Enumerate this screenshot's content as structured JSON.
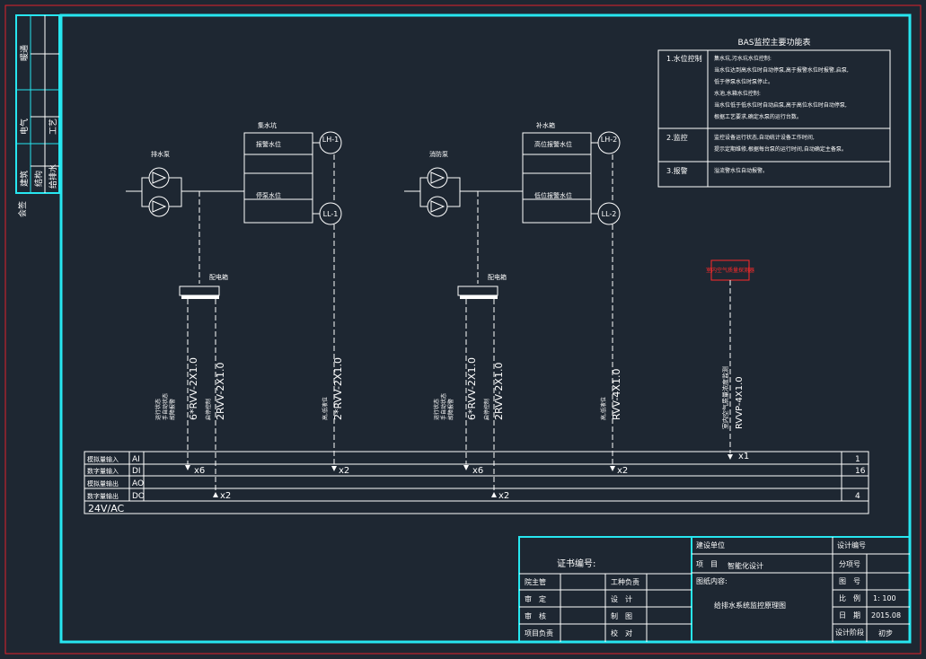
{
  "side_block": {
    "labels": [
      "暖通",
      "电气",
      "工艺",
      "建筑",
      "结构",
      "给排水"
    ],
    "company": "会签"
  },
  "sections": [
    {
      "pump_label": "排水泵",
      "tank_label": "集水坑",
      "level_high": "报警水位",
      "level_low": "停泵水位",
      "sensor_high": "LH-1",
      "sensor_low": "LL-1",
      "box_label": "配电箱",
      "cable1_desc": [
        "运行状态",
        "手自动状态",
        "故障报警"
      ],
      "cable1": "6*RVV-2X1.0",
      "cable2_desc": "启停控制",
      "cable2": "2RVV-2X1.0",
      "cable3_desc": "高,低液位",
      "cable3": "2*RVV-2X1.0",
      "di_count1": "x6",
      "do_count": "x2",
      "di_count2": "x2"
    },
    {
      "pump_label": "消防泵",
      "tank_label": "补水箱",
      "level_high": "高位报警水位",
      "level_low": "低位报警水位",
      "sensor_high": "LH-2",
      "sensor_low": "LL-2",
      "box_label": "配电箱",
      "cable1_desc": [
        "运行状态",
        "手自动状态",
        "故障报警"
      ],
      "cable1": "6*RVV-2X1.0",
      "cable2_desc": "启停控制",
      "cable2": "2RVV-2X1.0",
      "cable3_desc": "高,低液位",
      "cable3": "RVV-4X1.0",
      "di_count1": "x6",
      "do_count": "x2",
      "di_count2": "x2"
    }
  ],
  "gas_detector": {
    "label": "室内空气质量探测器",
    "cable_desc": "室内空气质量浓度监测",
    "cable": "RVVP-4X1.0",
    "ai_count": "x1"
  },
  "bas_table": {
    "title": "BAS监控主要功能表",
    "rows": [
      {
        "name": "1.水位控制",
        "lines": [
          "集水坑,污水坑水位控制:",
          "当水位达到高水位时自动停泵,高于报警水位时报警,启泵,",
          "低于停泵水位时泵停止。",
          "水池,水箱水位控制:",
          "当水位低于低水位时自动启泵,高于高位水位时自动停泵,",
          "根据工艺要求,确定水泵的运行台数。"
        ]
      },
      {
        "name": "2.监控",
        "lines": [
          "监控设备运行状态,自动统计设备工作时间,",
          "提示定期维修,根据每台泵的运行时间,自动确定主备泵。"
        ]
      },
      {
        "name": "3.报警",
        "lines": [
          "溢流警水位自动报警。"
        ]
      }
    ]
  },
  "io_table": {
    "rows": [
      {
        "label": "模拟量输入",
        "code": "AI",
        "total": "1"
      },
      {
        "label": "数字量输入",
        "code": "DI",
        "total": "16"
      },
      {
        "label": "模拟量输出",
        "code": "AO",
        "total": ""
      },
      {
        "label": "数字量输出",
        "code": "DO",
        "total": "4"
      }
    ],
    "power": "24V/AC"
  },
  "title_block": {
    "cert": "证书编号:",
    "client_label": "建设单位",
    "project_label": "项　目",
    "project_value": "智能化设计",
    "drawing_name_label": "图纸内容:",
    "drawing_name": "给排水系统监控原理图",
    "design_no_label": "设计编号",
    "sub_item_label": "分项号",
    "drawing_no_label": "图　号",
    "scale_label": "比　例",
    "scale_value": "1: 100",
    "date_label": "日　期",
    "date_value": "2015.08",
    "stage_label": "设计阶段",
    "stage_value": "初步",
    "left_rows": [
      [
        "院主管",
        "工种负责"
      ],
      [
        "审　定",
        "设　计"
      ],
      [
        "审　核",
        "制　图"
      ],
      [
        "项目负责",
        "校　对"
      ]
    ]
  },
  "colors": {
    "background": "#1e2732",
    "frame_outer": "#e0202a",
    "frame_inner": "#27e6f0",
    "lines": "#ffffff",
    "alert": "#ff2a2a"
  }
}
